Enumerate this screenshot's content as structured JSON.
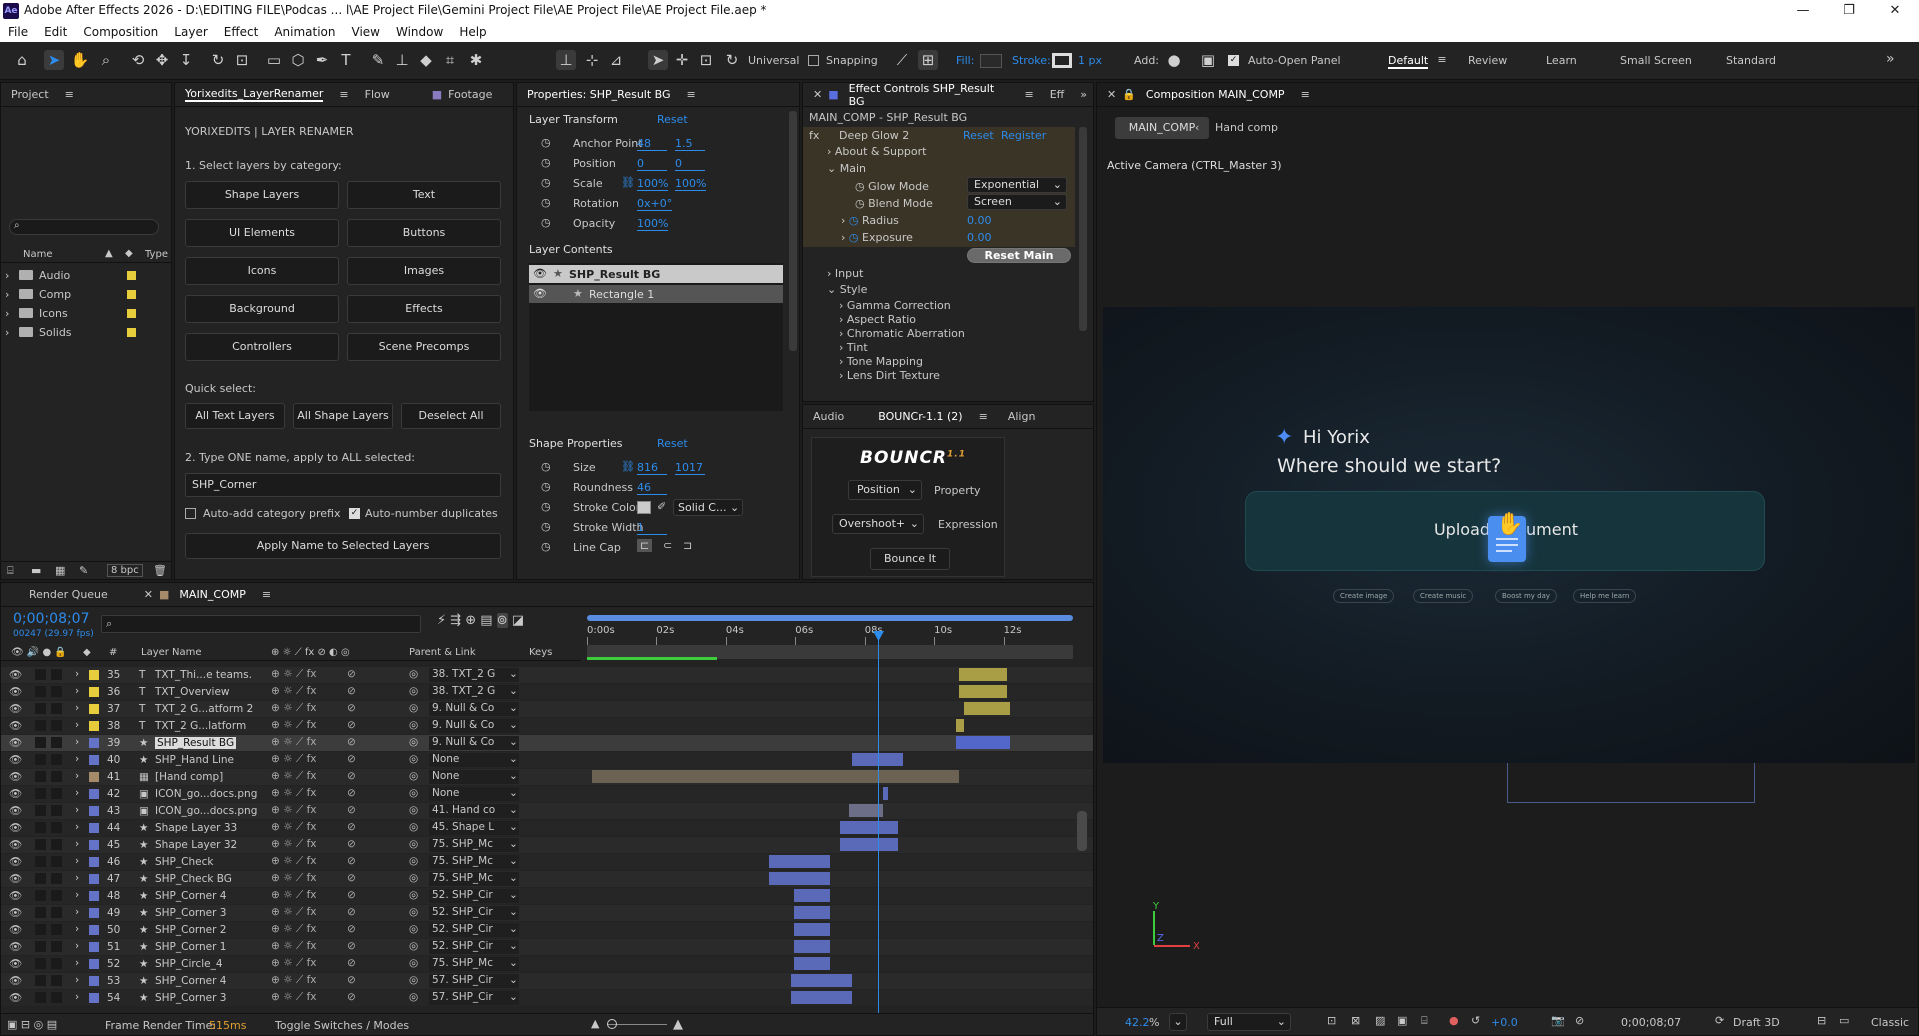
{
  "window": {
    "title": "Adobe After Effects 2026 - D:\\EDITING FILE\\Podcas ... l\\AE Project File\\Gemini Project File\\AE Project File\\AE Project File.aep *",
    "app_icon": "Ae",
    "minimize": "—",
    "restore": "❐",
    "close": "✕"
  },
  "menu": [
    "File",
    "Edit",
    "Composition",
    "Layer",
    "Effect",
    "Animation",
    "View",
    "Window",
    "Help"
  ],
  "toolbar": {
    "universal": "Universal",
    "snapping": "Snapping",
    "fill": "Fill:",
    "stroke": "Stroke:",
    "stroke_px": "1 px",
    "add": "Add:",
    "auto_open": "Auto-Open Panel",
    "workspaces": [
      "Default",
      "Review",
      "Learn",
      "Small Screen",
      "Standard"
    ],
    "more": "»"
  },
  "project": {
    "tab": "Project",
    "search_icon": "search-icon",
    "col_name": "Name",
    "col_type": "Type",
    "folders": [
      {
        "name": "Audio",
        "color": "#e7cd3c"
      },
      {
        "name": "Comp",
        "color": "#e7cd3c"
      },
      {
        "name": "Icons",
        "color": "#e7cd3c"
      },
      {
        "name": "Solids",
        "color": "#e7cd3c"
      }
    ],
    "bpc": "8 bpc"
  },
  "renamer": {
    "tabs": [
      "Yorixedits_LayerRenamer",
      "Flow",
      "Footage"
    ],
    "header": "YORIXEDITS | LAYER RENAMER",
    "step1": "1. Select layers by category:",
    "cats": [
      "Shape Layers",
      "Text",
      "UI Elements",
      "Buttons",
      "Icons",
      "Images",
      "Background",
      "Effects",
      "Controllers",
      "Scene Precomps"
    ],
    "quick": "Quick select:",
    "quick_btns": [
      "All Text Layers",
      "All Shape Layers",
      "Deselect All"
    ],
    "step2": "2. Type ONE name, apply to ALL selected:",
    "name_value": "SHP_Corner",
    "auto_prefix": "Auto-add category prefix",
    "auto_number": "Auto-number duplicates",
    "apply": "Apply Name to Selected Layers"
  },
  "properties": {
    "tab": "Properties: SHP_Result BG",
    "layer_transform": "Layer Transform",
    "reset": "Reset",
    "rows": [
      {
        "name": "Anchor Point",
        "v1": "48",
        "v2": "1.5"
      },
      {
        "name": "Position",
        "v1": "0",
        "v2": "0"
      },
      {
        "name": "Scale",
        "v1": "100%",
        "v2": "100%"
      },
      {
        "name": "Rotation",
        "v1": "0x+0°",
        "v2": ""
      },
      {
        "name": "Opacity",
        "v1": "100%",
        "v2": ""
      }
    ],
    "layer_contents": "Layer Contents",
    "contents": [
      "SHP_Result BG",
      "Rectangle 1"
    ],
    "shape_props": "Shape Properties",
    "shape_reset": "Reset",
    "shape_rows": [
      {
        "name": "Size",
        "v1": "816",
        "v2": "1017"
      },
      {
        "name": "Roundness",
        "v1": "46",
        "v2": ""
      },
      {
        "name": "Stroke Color",
        "v1": "",
        "v2": "Solid C..."
      },
      {
        "name": "Stroke Width",
        "v1": "1",
        "v2": ""
      },
      {
        "name": "Line Cap",
        "v1": "",
        "v2": ""
      }
    ]
  },
  "effects": {
    "tab": "Effect Controls SHP_Result BG",
    "tab2": "Eff",
    "breadcrumb": "MAIN_COMP - SHP_Result BG",
    "fx": "fx",
    "effect": "Deep Glow 2",
    "reset": "Reset",
    "register": "Register",
    "items": [
      "About & Support",
      "Main"
    ],
    "glow_mode_lbl": "Glow Mode",
    "glow_mode": "Exponential",
    "blend_lbl": "Blend Mode",
    "blend": "Screen",
    "radius_lbl": "Radius",
    "radius": "0.00",
    "exposure_lbl": "Exposure",
    "exposure": "0.00",
    "reset_main": "Reset Main",
    "groups": [
      "Input",
      "Style"
    ],
    "style_items": [
      "Gamma Correction",
      "Aspect Ratio",
      "Chromatic Aberration",
      "Tint",
      "Tone Mapping",
      "Lens Dirt Texture"
    ]
  },
  "bouncr": {
    "tabs": [
      "Audio",
      "BOUNCr-1.1 (2)",
      "Align"
    ],
    "logo": "BOUNCR",
    "ver": "1.1",
    "prop_sel": "Position",
    "prop_lbl": "Property",
    "expr_sel": "Overshoot+",
    "expr_lbl": "Expression",
    "button": "Bounce It"
  },
  "comp": {
    "tab": "Composition MAIN_COMP",
    "crumb1": "MAIN_COMP",
    "crumb2": "Hand comp",
    "camera": "Active Camera (CTRL_Master 3)",
    "hi": "Hi Yorix",
    "question": "Where should we start?",
    "upload": "Upload Document",
    "chips": [
      "Create image",
      "Create music",
      "Boost my day",
      "Help me learn"
    ],
    "zoom": "42.2",
    "zoom_unit": "%",
    "res": "Full",
    "exposure": "+0.0",
    "timecode": "0;00;08;07",
    "renderer": "Draft 3D",
    "classic": "Classic",
    "axis_y": "Y",
    "axis_z": "Z",
    "axis_x": "X"
  },
  "timeline": {
    "tabs": [
      "Render Queue",
      "MAIN_COMP"
    ],
    "timecode": "0;00;08;07",
    "fps": "00247 (29.97 fps)",
    "col_layer": "Layer Name",
    "col_parent": "Parent & Link",
    "col_keys": "Keys",
    "ruler": [
      "0:00s",
      "02s",
      "04s",
      "06s",
      "08s",
      "10s",
      "12s"
    ],
    "footer_lbl": "Frame Render Time:",
    "footer_val": "515ms",
    "toggle": "Toggle Switches / Modes",
    "layers": [
      {
        "n": "35",
        "t": "T",
        "name": "TXT_Thi...e teams.",
        "parent": "38. TXT_2 G",
        "color": "#e7cd3c",
        "bar": [
          0.765,
          0.865
        ],
        "barc": "#a99e45"
      },
      {
        "n": "36",
        "t": "T",
        "name": "TXT_Overview",
        "parent": "38. TXT_2 G",
        "color": "#e7cd3c",
        "bar": [
          0.765,
          0.865
        ],
        "barc": "#a99e45"
      },
      {
        "n": "37",
        "t": "T",
        "name": "TXT_2 G...atform 2",
        "parent": "9. Null & Co",
        "color": "#e7cd3c",
        "bar": [
          0.775,
          0.87
        ],
        "barc": "#a99e45"
      },
      {
        "n": "38",
        "t": "T",
        "name": "TXT_2 G...latform",
        "parent": "9. Null & Co",
        "color": "#e7cd3c",
        "bar": [
          0.76,
          0.775
        ],
        "barc": "#a99e45"
      },
      {
        "n": "39",
        "t": "★",
        "name": "SHP_Result BG",
        "parent": "9. Null & Co",
        "color": "#6473c7",
        "bar": [
          0.76,
          0.87
        ],
        "barc": "#5366c9",
        "selected": true
      },
      {
        "n": "40",
        "t": "★",
        "name": "SHP_Hand Line",
        "parent": "None",
        "color": "#6473c7",
        "bar": [
          0.545,
          0.65
        ],
        "barc": "#5a69b8"
      },
      {
        "n": "41",
        "t": "▦",
        "name": "[Hand comp]",
        "parent": "None",
        "color": "#a68b6a",
        "bar": [
          0.01,
          0.765
        ],
        "barc": "#6b6253"
      },
      {
        "n": "42",
        "t": "▣",
        "name": "ICON_go...docs.png",
        "parent": "None",
        "color": "#6473c7",
        "bar": [
          0.61,
          0.62
        ],
        "barc": "#5a69b8"
      },
      {
        "n": "43",
        "t": "▣",
        "name": "ICON_go...docs.png",
        "parent": "41. Hand co",
        "color": "#6473c7",
        "bar": [
          0.54,
          0.61
        ],
        "barc": "#6b6e86"
      },
      {
        "n": "44",
        "t": "★",
        "name": "Shape Layer 33",
        "parent": "45. Shape L",
        "color": "#6473c7",
        "bar": [
          0.52,
          0.64
        ],
        "barc": "#5a69b8"
      },
      {
        "n": "45",
        "t": "★",
        "name": "Shape Layer 32",
        "parent": "75. SHP_Mc",
        "color": "#6473c7",
        "bar": [
          0.52,
          0.64
        ],
        "barc": "#5a69b8"
      },
      {
        "n": "46",
        "t": "★",
        "name": "SHP_Check",
        "parent": "75. SHP_Mc",
        "color": "#6473c7",
        "bar": [
          0.375,
          0.5
        ],
        "barc": "#5a69b8"
      },
      {
        "n": "47",
        "t": "★",
        "name": "SHP_Check BG",
        "parent": "75. SHP_Mc",
        "color": "#6473c7",
        "bar": [
          0.375,
          0.5
        ],
        "barc": "#5a69b8"
      },
      {
        "n": "48",
        "t": "★",
        "name": "SHP_Corner 4",
        "parent": "52. SHP_Cir",
        "color": "#6473c7",
        "bar": [
          0.425,
          0.5
        ],
        "barc": "#5a69b8"
      },
      {
        "n": "49",
        "t": "★",
        "name": "SHP_Corner 3",
        "parent": "52. SHP_Cir",
        "color": "#6473c7",
        "bar": [
          0.425,
          0.5
        ],
        "barc": "#5a69b8"
      },
      {
        "n": "50",
        "t": "★",
        "name": "SHP_Corner 2",
        "parent": "52. SHP_Cir",
        "color": "#6473c7",
        "bar": [
          0.425,
          0.5
        ],
        "barc": "#5a69b8"
      },
      {
        "n": "51",
        "t": "★",
        "name": "SHP_Corner 1",
        "parent": "52. SHP_Cir",
        "color": "#6473c7",
        "bar": [
          0.425,
          0.5
        ],
        "barc": "#5a69b8"
      },
      {
        "n": "52",
        "t": "★",
        "name": "SHP_Circle_4",
        "parent": "75. SHP_Mc",
        "color": "#6473c7",
        "bar": [
          0.425,
          0.5
        ],
        "barc": "#5a69b8"
      },
      {
        "n": "53",
        "t": "★",
        "name": "SHP_Corner 4",
        "parent": "57. SHP_Cir",
        "color": "#6473c7",
        "bar": [
          0.42,
          0.545
        ],
        "barc": "#5a69b8"
      },
      {
        "n": "54",
        "t": "★",
        "name": "SHP_Corner 3",
        "parent": "57. SHP_Cir",
        "color": "#6473c7",
        "bar": [
          0.42,
          0.545
        ],
        "barc": "#5a69b8"
      }
    ]
  }
}
